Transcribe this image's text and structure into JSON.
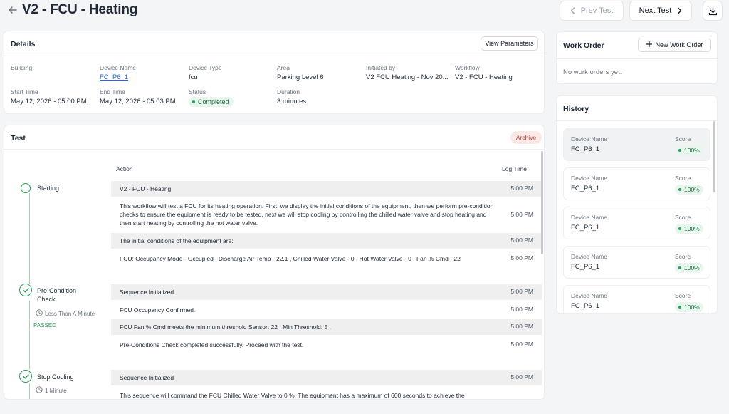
{
  "header": {
    "title": "V2 - FCU - Heating",
    "prev_label": "Prev Test",
    "next_label": "Next Test"
  },
  "details": {
    "title": "Details",
    "view_params_label": "View Parameters",
    "fields": {
      "building": {
        "label": "Building",
        "value": ""
      },
      "device_name": {
        "label": "Device Name",
        "value": "FC_P6_1"
      },
      "device_type": {
        "label": "Device Type",
        "value": "fcu"
      },
      "area": {
        "label": "Area",
        "value": "Parking Level 6"
      },
      "initiated_by": {
        "label": "Initiated by",
        "value": "V2 FCU Heating - Nov 20..."
      },
      "workflow": {
        "label": "Workflow",
        "value": "V2 - FCU - Heating"
      },
      "start_time": {
        "label": "Start Time",
        "value": "May 12, 2026 - 05:00 PM"
      },
      "end_time": {
        "label": "End Time",
        "value": "May 12, 2026 - 05:03 PM"
      },
      "status": {
        "label": "Status",
        "value": "Completed"
      },
      "duration": {
        "label": "Duration",
        "value": "3 minutes"
      }
    }
  },
  "test": {
    "title": "Test",
    "archive_label": "Archive",
    "action_header": "Action",
    "log_time_header": "Log Time",
    "steps": [
      {
        "label": "Starting"
      },
      {
        "label": "Pre-Condition Check",
        "duration": "Less Than A Minute",
        "result": "PASSED"
      },
      {
        "label": "Stop Cooling",
        "duration": "1 Minute"
      }
    ],
    "rows": [
      {
        "text": "V2 - FCU - Heating",
        "time": "5:00 PM"
      },
      {
        "text": "This workflow will test a FCU for its heating operation. First, we display the initial conditions of the equipment, then we perform pre-condition checks to ensure the equipment is ready to be tested, next we will stop cooling by controlling the chilled water valve and stop heating and then start heating by controlling the hot water valve.",
        "time": "5:00 PM"
      },
      {
        "text": "The initial conditions of the equipment are:",
        "time": "5:00 PM"
      },
      {
        "text": "FCU: Occupancy Mode - Occupied , Discharge Air Temp - 22.1 , Chilled Water Valve - 0 , Hot Water Valve - 0 , Fan % Cmd - 22",
        "time": "5:00 PM"
      },
      {
        "text": "Sequence Initialized",
        "time": "5:00 PM"
      },
      {
        "text": "FCU Occupancy Confirmed.",
        "time": "5:00 PM"
      },
      {
        "text": "FCU Fan % Cmd meets the minimum threshold Sensor: 22 , Min Threshold: 5 .",
        "time": "5:00 PM"
      },
      {
        "text": "Pre-Conditions Check completed successfully. Proceed with the test.",
        "time": "5:00 PM"
      },
      {
        "text": "Sequence Initialized",
        "time": "5:00 PM"
      },
      {
        "text": "This sequence will command the FCU Chilled Water Valve to 0 %. The equipment has a maximum of 600 seconds to achieve the",
        "time": ""
      }
    ]
  },
  "work_order": {
    "title": "Work Order",
    "new_label": "New Work Order",
    "empty_text": "No work orders yet."
  },
  "history": {
    "title": "History",
    "items": [
      {
        "name_label": "Device Name",
        "name": "FC_P6_1",
        "score_label": "Score",
        "score": "100%"
      },
      {
        "name_label": "Device Name",
        "name": "FC_P6_1",
        "score_label": "Score",
        "score": "100%"
      },
      {
        "name_label": "Device Name",
        "name": "FC_P6_1",
        "score_label": "Score",
        "score": "100%"
      },
      {
        "name_label": "Device Name",
        "name": "FC_P6_1",
        "score_label": "Score",
        "score": "100%"
      },
      {
        "name_label": "Device Name",
        "name": "FC_P6_1",
        "score_label": "Score",
        "score": "100%"
      }
    ]
  },
  "colors": {
    "accent_green": "#2a9d5c",
    "link_blue": "#2563eb",
    "archive_red": "#c0392b"
  }
}
